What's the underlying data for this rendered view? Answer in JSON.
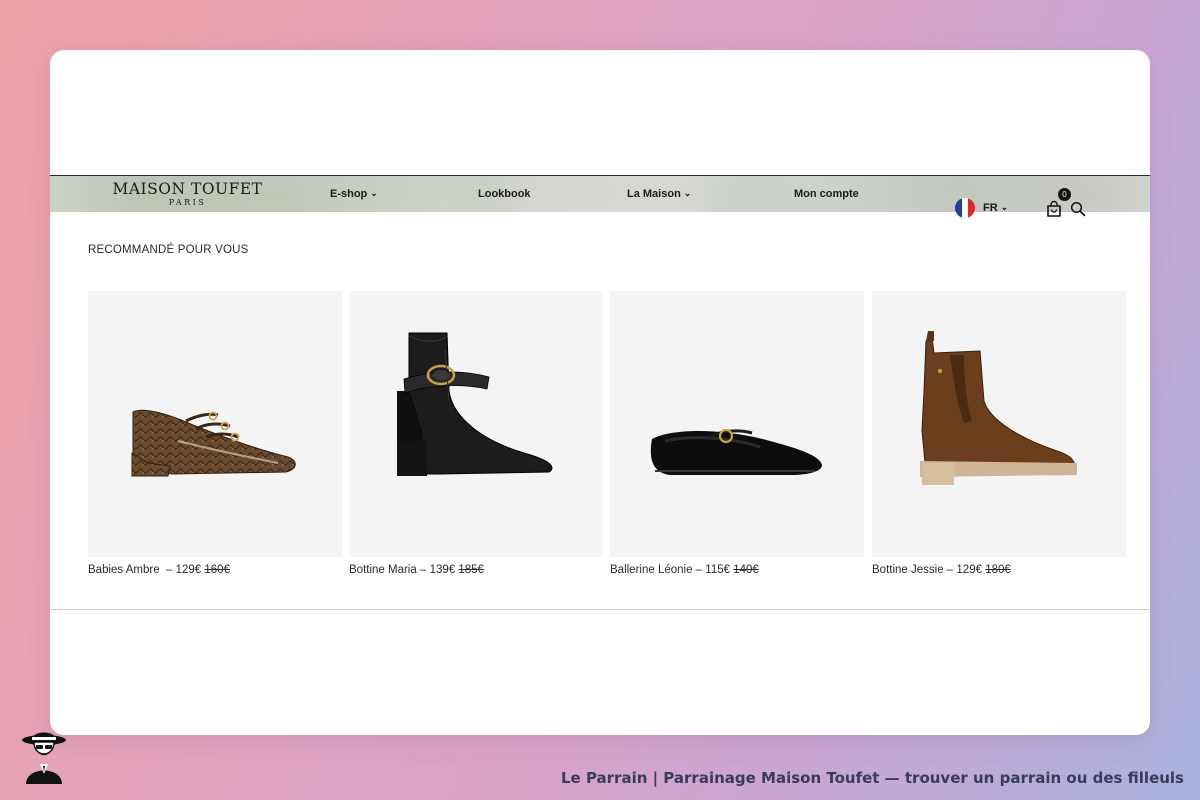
{
  "header": {
    "logo_main": "MAISON TOUFET",
    "logo_sub": "PARIS"
  },
  "nav": {
    "eshop": "E-shop",
    "lookbook": "Lookbook",
    "la_maison": "La Maison",
    "mon_compte": "Mon compte",
    "language": "FR",
    "cart_count": "0"
  },
  "section_title": "RECOMMANDÉ POUR VOUS",
  "products": [
    {
      "name": "Babies Ambre",
      "price": "129€",
      "old_price": "160€"
    },
    {
      "name": "Bottine Maria",
      "price": "139€",
      "old_price": "185€"
    },
    {
      "name": "Ballerine Léonie",
      "price": "115€",
      "old_price": "140€"
    },
    {
      "name": "Bottine Jessie",
      "price": "129€",
      "old_price": "180€"
    }
  ],
  "footer": {
    "caption": "Le Parrain | Parrainage Maison Toufet — trouver un parrain ou des filleuls"
  },
  "icons": {
    "flag": "france-flag-icon",
    "cart": "shopping-bag-icon",
    "search": "search-icon",
    "chevron": "chevron-down-icon",
    "mascot": "le-parrain-mascot-icon"
  }
}
